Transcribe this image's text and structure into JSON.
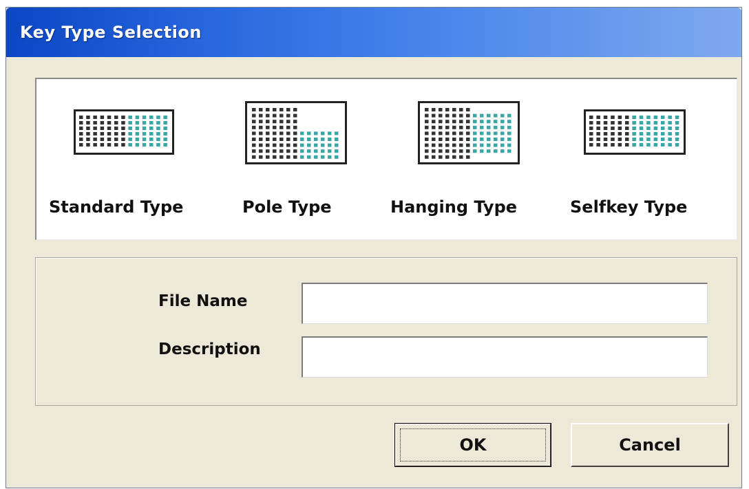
{
  "window": {
    "title": "Key Type Selection"
  },
  "key_types": [
    {
      "label": "Standard Type",
      "icon": "standard-keyboard-icon"
    },
    {
      "label": "Pole Type",
      "icon": "pole-keyboard-icon"
    },
    {
      "label": "Hanging Type",
      "icon": "hanging-keyboard-icon"
    },
    {
      "label": "Selfkey Type",
      "icon": "selfkey-keyboard-icon"
    }
  ],
  "fields": {
    "file_name": {
      "label": "File Name",
      "value": ""
    },
    "description": {
      "label": "Description",
      "value": ""
    }
  },
  "buttons": {
    "ok": "OK",
    "cancel": "Cancel"
  },
  "colors": {
    "title_bar": "#0B46C4",
    "dialog_bg": "#ECE9D8",
    "key_dark": "#333333",
    "key_teal": "#3AA7A7"
  }
}
